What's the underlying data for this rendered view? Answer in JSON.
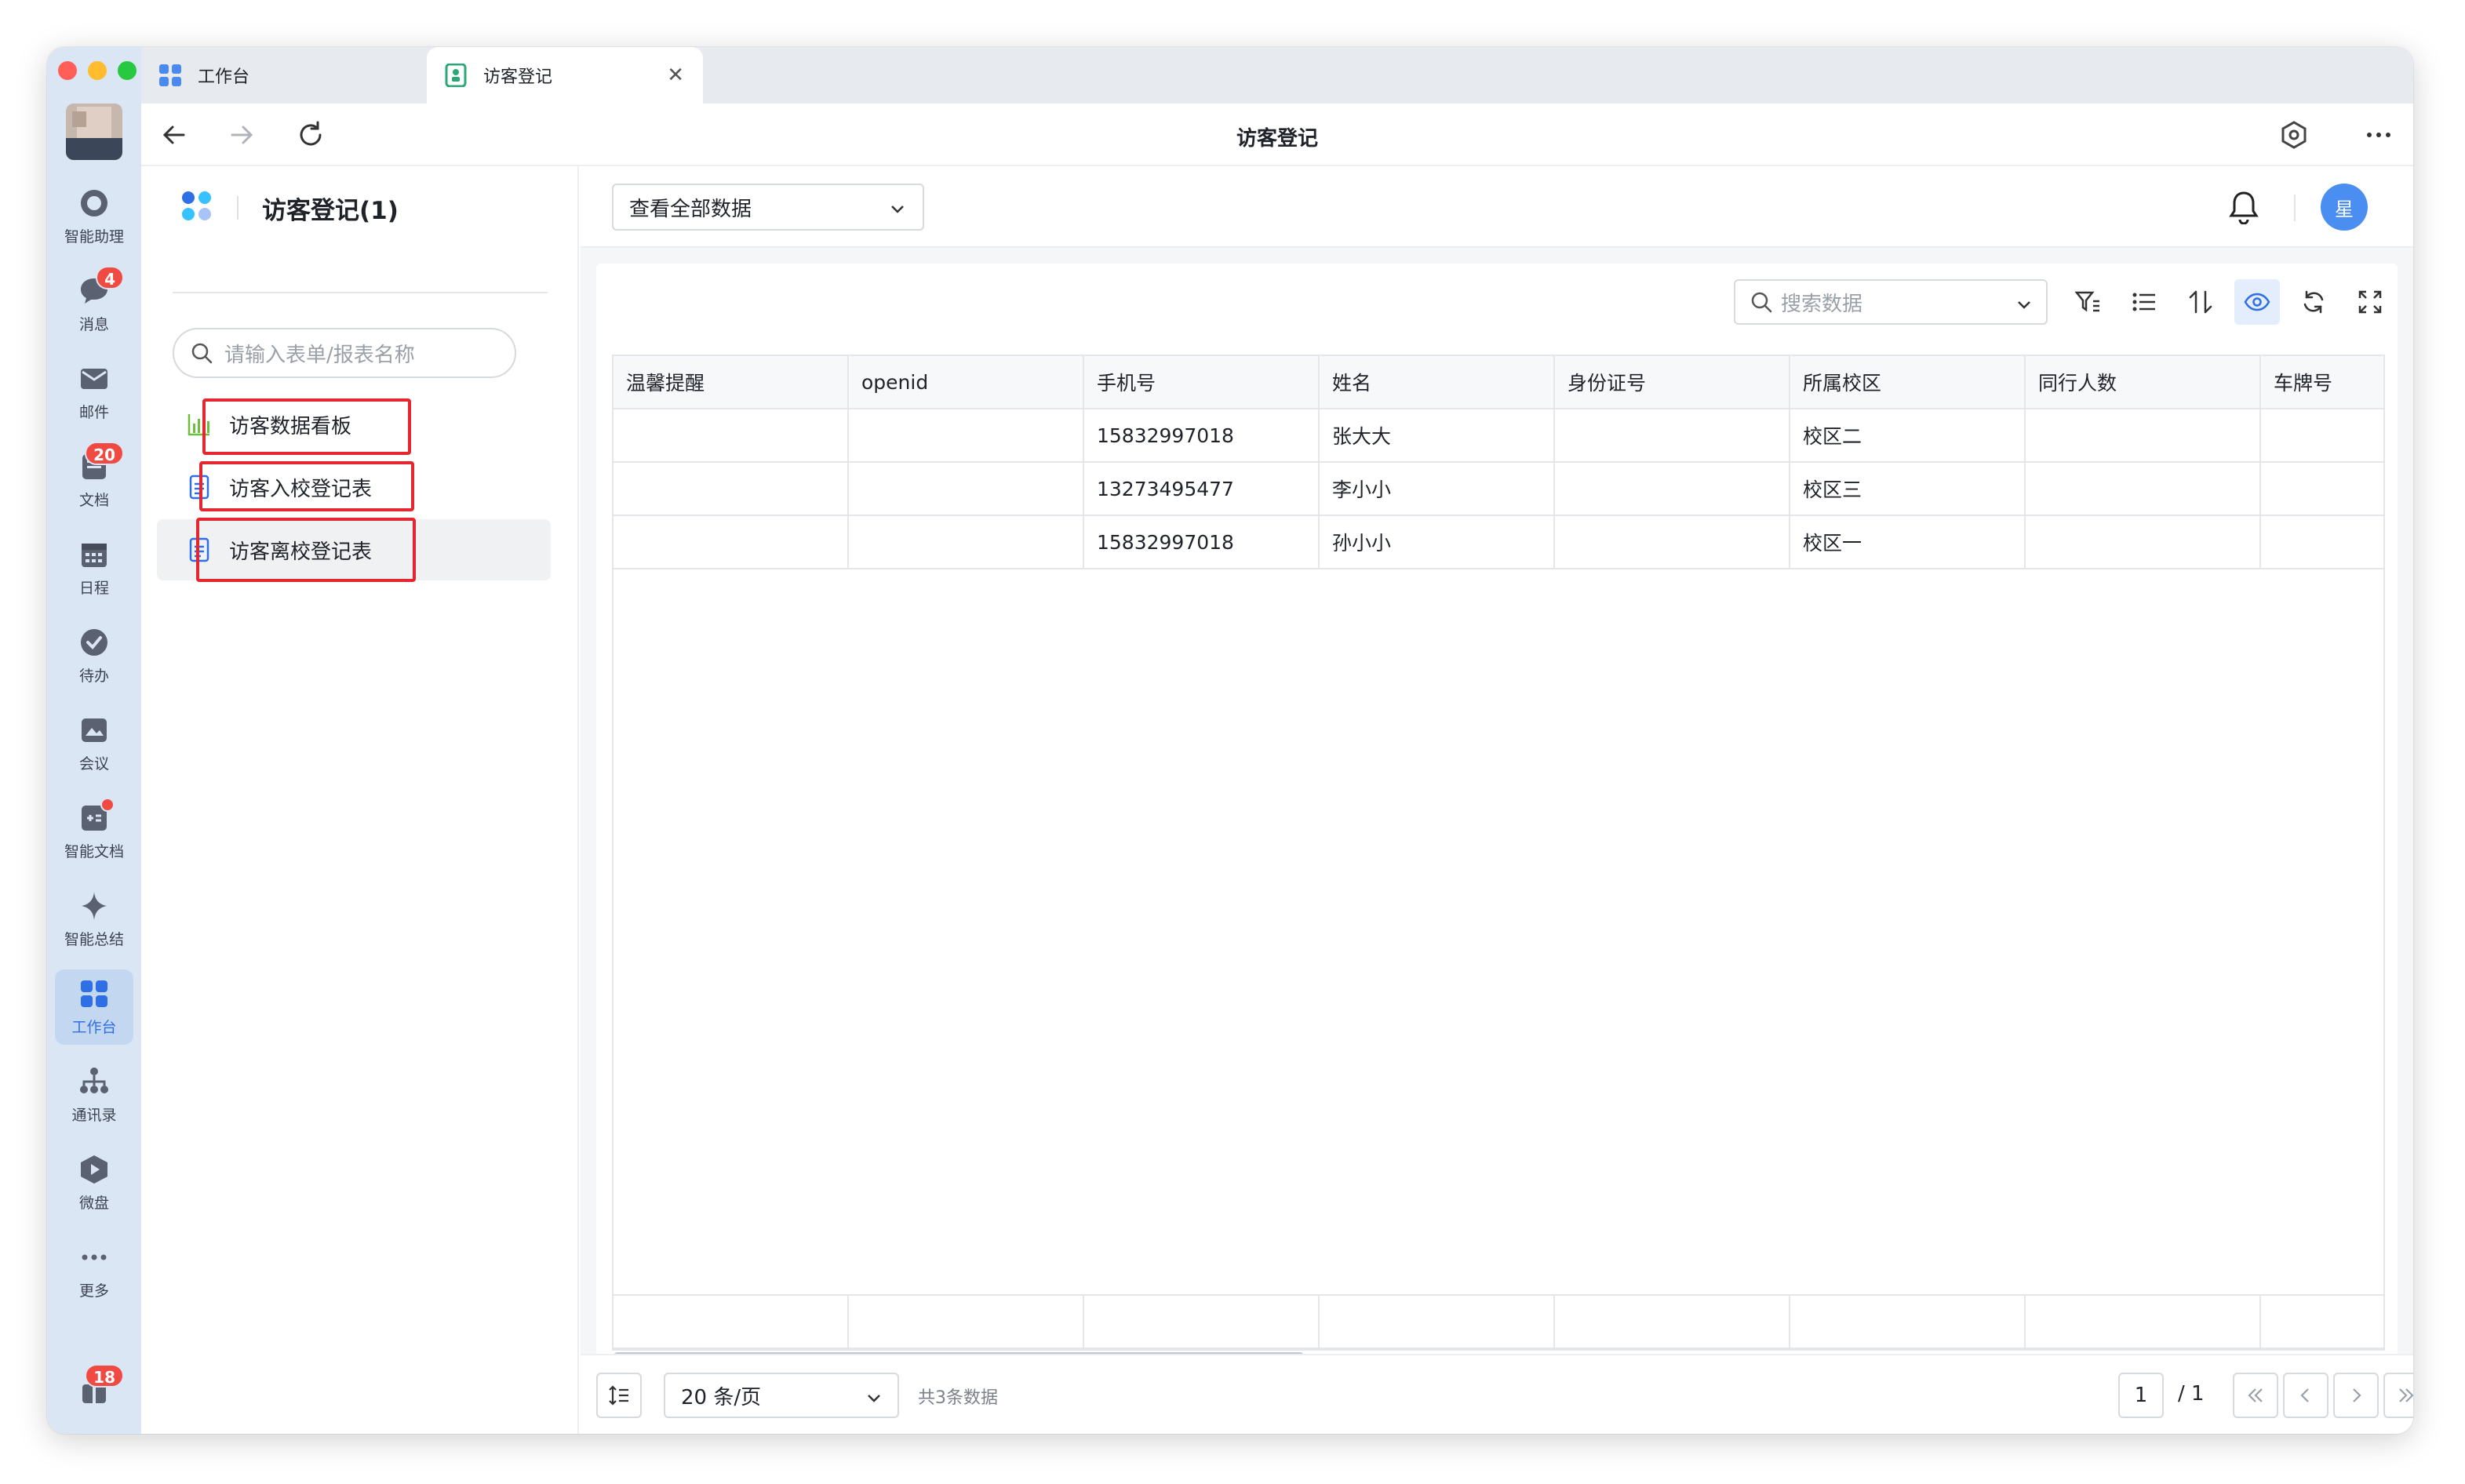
{
  "window": {
    "traffic_lights": [
      "#ff5f57",
      "#febc2e",
      "#28c840"
    ]
  },
  "rail": {
    "items": [
      {
        "label": "智能助理",
        "icon": "assistant-icon"
      },
      {
        "label": "消息",
        "icon": "chat-icon",
        "badge": "4"
      },
      {
        "label": "邮件",
        "icon": "mail-icon"
      },
      {
        "label": "文档",
        "icon": "doc-icon",
        "badge": "20"
      },
      {
        "label": "日程",
        "icon": "calendar-icon"
      },
      {
        "label": "待办",
        "icon": "todo-check-icon"
      },
      {
        "label": "会议",
        "icon": "meeting-icon"
      },
      {
        "label": "智能文档",
        "icon": "smart-doc-icon"
      },
      {
        "label": "智能总结",
        "icon": "sparkle-icon"
      },
      {
        "label": "工作台",
        "icon": "workbench-icon",
        "active": true
      },
      {
        "label": "通讯录",
        "icon": "contacts-icon"
      },
      {
        "label": "微盘",
        "icon": "drive-icon"
      },
      {
        "label": "更多",
        "icon": "more-icon"
      }
    ],
    "bottom_badge": "18"
  },
  "tabs": [
    {
      "label": "工作台",
      "icon": "workbench-tab-icon"
    },
    {
      "label": "访客登记",
      "icon": "visitor-tab-icon",
      "active": true
    }
  ],
  "navbar": {
    "title": "访客登记"
  },
  "side": {
    "title": "访客登记(1)",
    "search_placeholder": "请输入表单/报表名称",
    "items": [
      {
        "label": "访客数据看板",
        "icon": "bar-chart-icon"
      },
      {
        "label": "访客入校登记表",
        "icon": "form-doc-icon"
      },
      {
        "label": "访客离校登记表",
        "icon": "form-doc-icon",
        "selected": true
      }
    ]
  },
  "main": {
    "view_select": "查看全部数据",
    "user_avatar": "星",
    "search_placeholder": "搜索数据",
    "columns": [
      "温馨提醒",
      "openid",
      "手机号",
      "姓名",
      "身份证号",
      "所属校区",
      "同行人数",
      "车牌号"
    ],
    "rows": [
      [
        "",
        "",
        "15832997018",
        "张大大",
        "",
        "校区二",
        "",
        ""
      ],
      [
        "",
        "",
        "13273495477",
        "李小小",
        "",
        "校区三",
        "",
        ""
      ],
      [
        "",
        "",
        "15832997018",
        "孙小小",
        "",
        "校区一",
        "",
        ""
      ]
    ],
    "footer": {
      "page_size": "20 条/页",
      "total": "共3条数据",
      "current_page": "1",
      "total_pages": "/ 1"
    }
  },
  "colors": {
    "accent": "#2f6fe6",
    "highlight_box": "#e5262e",
    "rail_bg": "#dbe6f4"
  }
}
